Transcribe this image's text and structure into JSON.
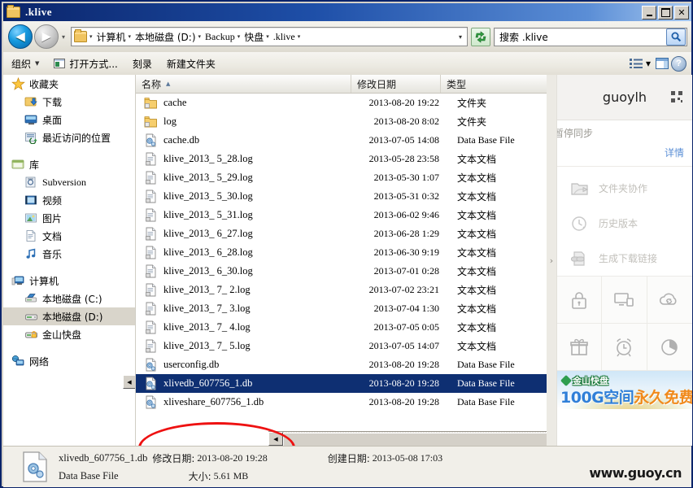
{
  "window": {
    "title": ".klive",
    "buttons": {
      "minimize": "_",
      "maximize": "□",
      "close": "✕"
    }
  },
  "nav": {
    "back_icon": "◀",
    "forward_icon": "▶",
    "history_caret": "▾",
    "breadcrumbs": [
      {
        "label": "计算机",
        "cjk": true
      },
      {
        "label": "本地磁盘 (D:)",
        "cjk": true
      },
      {
        "label": "Backup",
        "cjk": false
      },
      {
        "label": "快盘",
        "cjk": true
      },
      {
        "label": ".klive",
        "cjk": false
      }
    ],
    "refresh_title": "刷新",
    "search": {
      "placeholder": "搜索 .klive",
      "value": ""
    }
  },
  "toolbar": {
    "organize": "组织",
    "open_with": "打开方式...",
    "burn": "刻录",
    "new_folder": "新建文件夹",
    "view_caret": "▾"
  },
  "sidebar": {
    "groups": [
      {
        "header": {
          "label": "收藏夹",
          "icon": "star-icon"
        },
        "items": [
          {
            "label": "下载",
            "icon": "downloads-icon"
          },
          {
            "label": "桌面",
            "icon": "desktop-icon"
          },
          {
            "label": "最近访问的位置",
            "icon": "recent-places-icon"
          }
        ]
      },
      {
        "header": {
          "label": "库",
          "icon": "library-icon"
        },
        "items": [
          {
            "label": "Subversion",
            "icon": "subversion-icon"
          },
          {
            "label": "视频",
            "icon": "video-icon"
          },
          {
            "label": "图片",
            "icon": "pictures-icon"
          },
          {
            "label": "文档",
            "icon": "documents-icon"
          },
          {
            "label": "音乐",
            "icon": "music-icon"
          }
        ]
      },
      {
        "header": {
          "label": "计算机",
          "icon": "computer-icon"
        },
        "items": [
          {
            "label": "本地磁盘 (C:)",
            "icon": "os-drive-icon",
            "selected": false
          },
          {
            "label": "本地磁盘 (D:)",
            "icon": "drive-icon",
            "selected": true
          },
          {
            "label": "金山快盘",
            "icon": "kuaipan-icon",
            "selected": false
          }
        ]
      },
      {
        "header": {
          "label": "网络",
          "icon": "network-icon"
        },
        "items": []
      }
    ]
  },
  "filelist": {
    "columns": [
      {
        "key": "name",
        "label": "名称",
        "sorted": true,
        "sort_arrow": "▲"
      },
      {
        "key": "date",
        "label": "修改日期"
      },
      {
        "key": "type",
        "label": "类型"
      }
    ],
    "rows": [
      {
        "name": "cache",
        "date": "2013-08-20 19:22",
        "type": "文件夹",
        "icon": "folder-icon",
        "type_en": false,
        "selected": false
      },
      {
        "name": "log",
        "date": "2013-08-20 8:02",
        "type": "文件夹",
        "icon": "folder-icon",
        "type_en": false,
        "selected": false
      },
      {
        "name": "cache.db",
        "date": "2013-07-05 14:08",
        "type": "Data Base File",
        "icon": "database-icon",
        "type_en": true,
        "selected": false
      },
      {
        "name": "klive_2013_ 5_28.log",
        "date": "2013-05-28 23:58",
        "type": "文本文档",
        "icon": "textfile-icon",
        "type_en": false,
        "selected": false
      },
      {
        "name": "klive_2013_ 5_29.log",
        "date": "2013-05-30 1:07",
        "type": "文本文档",
        "icon": "textfile-icon",
        "type_en": false,
        "selected": false
      },
      {
        "name": "klive_2013_ 5_30.log",
        "date": "2013-05-31 0:32",
        "type": "文本文档",
        "icon": "textfile-icon",
        "type_en": false,
        "selected": false
      },
      {
        "name": "klive_2013_ 5_31.log",
        "date": "2013-06-02 9:46",
        "type": "文本文档",
        "icon": "textfile-icon",
        "type_en": false,
        "selected": false
      },
      {
        "name": "klive_2013_ 6_27.log",
        "date": "2013-06-28 1:29",
        "type": "文本文档",
        "icon": "textfile-icon",
        "type_en": false,
        "selected": false
      },
      {
        "name": "klive_2013_ 6_28.log",
        "date": "2013-06-30 9:19",
        "type": "文本文档",
        "icon": "textfile-icon",
        "type_en": false,
        "selected": false
      },
      {
        "name": "klive_2013_ 6_30.log",
        "date": "2013-07-01 0:28",
        "type": "文本文档",
        "icon": "textfile-icon",
        "type_en": false,
        "selected": false
      },
      {
        "name": "klive_2013_ 7_ 2.log",
        "date": "2013-07-02 23:21",
        "type": "文本文档",
        "icon": "textfile-icon",
        "type_en": false,
        "selected": false
      },
      {
        "name": "klive_2013_ 7_ 3.log",
        "date": "2013-07-04 1:30",
        "type": "文本文档",
        "icon": "textfile-icon",
        "type_en": false,
        "selected": false
      },
      {
        "name": "klive_2013_ 7_ 4.log",
        "date": "2013-07-05 0:05",
        "type": "文本文档",
        "icon": "textfile-icon",
        "type_en": false,
        "selected": false
      },
      {
        "name": "klive_2013_ 7_ 5.log",
        "date": "2013-07-05 14:07",
        "type": "文本文档",
        "icon": "textfile-icon",
        "type_en": false,
        "selected": false
      },
      {
        "name": "userconfig.db",
        "date": "2013-08-20 19:28",
        "type": "Data Base File",
        "icon": "database-icon",
        "type_en": true,
        "selected": false
      },
      {
        "name": "xlivedb_607756_1.db",
        "date": "2013-08-20 19:28",
        "type": "Data Base File",
        "icon": "database-icon",
        "type_en": true,
        "selected": true
      },
      {
        "name": "xliveshare_607756_1.db",
        "date": "2013-08-20 19:28",
        "type": "Data Base File",
        "icon": "database-icon",
        "type_en": true,
        "selected": false
      }
    ]
  },
  "splitter": {
    "collapse_chevron": "›"
  },
  "cloud": {
    "user": "guoylh",
    "qr_icon": "qr-code-icon",
    "status_text": "暂停同步",
    "detail_link": "详情",
    "actions": [
      {
        "label": "文件夹协作",
        "icon": "folder-share-icon"
      },
      {
        "label": "历史版本",
        "icon": "history-clock-icon"
      },
      {
        "label": "生成下载链接",
        "icon": "download-link-icon"
      }
    ],
    "grid_icons": [
      "lock-icon",
      "devices-icon",
      "cloud-sync-icon",
      "gift-icon",
      "alarm-clock-icon",
      "pie-quota-icon"
    ],
    "banner": {
      "brand": "金山快盘",
      "main_blue": "100G空间",
      "main_orange": "永久免费"
    }
  },
  "statusbar": {
    "file_icon": "database-file-icon",
    "filename": "xlivedb_607756_1.db",
    "filetype": "Data Base File",
    "modified_label": "修改日期:",
    "modified_value": "2013-08-20 19:28",
    "created_label": "创建日期:",
    "created_value": "2013-05-08 17:03",
    "size_label": "大小:",
    "size_value": "5.61 MB"
  },
  "watermark": "www.guoy.cn"
}
